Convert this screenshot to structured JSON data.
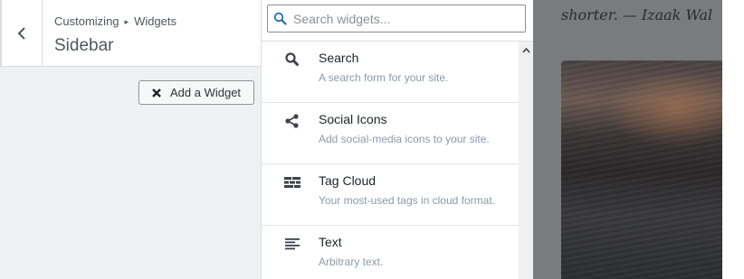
{
  "breadcrumb": {
    "root": "Customizing",
    "separator": "▸",
    "current": "Widgets"
  },
  "section_title": "Sidebar",
  "add_widget_button": {
    "label": "Add a Widget",
    "icon": "close-x-icon"
  },
  "search": {
    "placeholder": "Search widgets...",
    "value": "",
    "icon": "search-icon"
  },
  "widgets": [
    {
      "title": "Search",
      "description": "A search form for your site.",
      "icon": "search-icon"
    },
    {
      "title": "Social Icons",
      "description": "Add social-media icons to your site.",
      "icon": "share-icon"
    },
    {
      "title": "Tag Cloud",
      "description": "Your most-used tags in cloud format.",
      "icon": "tag-cloud-icon"
    },
    {
      "title": "Text",
      "description": "Arbitrary text.",
      "icon": "text-lines-icon"
    }
  ],
  "preview": {
    "quote_text": "shorter. — Izaak Wal"
  },
  "colors": {
    "panel_bg": "#eef0f2",
    "accent_blue": "#2271b1",
    "description_text": "#8a9aab",
    "preview_overlay": "#7a7b7c"
  }
}
